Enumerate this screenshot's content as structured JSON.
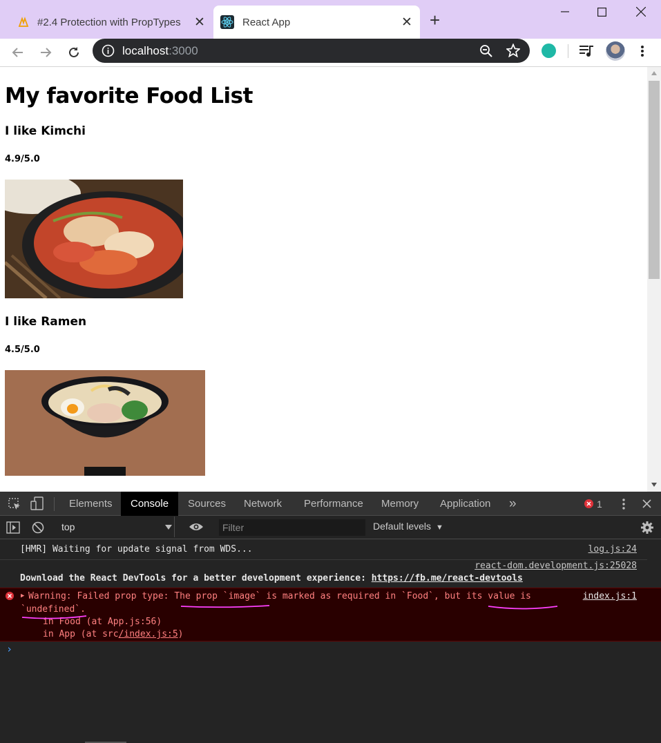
{
  "browser": {
    "tabs": [
      {
        "title": "#2.4 Protection with PropTypes",
        "icon": "nomad-logo-icon",
        "close": "✕"
      },
      {
        "title": "React App",
        "icon": "react-logo-icon",
        "close": "✕"
      }
    ],
    "new_tab": "+",
    "url_host": "localhost",
    "url_port": ":3000"
  },
  "page": {
    "heading": "My favorite Food List",
    "foods": [
      {
        "title": "I like Kimchi",
        "rating": "4.9/5.0",
        "image": "kimchi-photo"
      },
      {
        "title": "I like Ramen",
        "rating": "4.5/5.0",
        "image": "ramen-photo"
      }
    ]
  },
  "devtools": {
    "tabs": [
      "Elements",
      "Console",
      "Sources",
      "Network",
      "Performance",
      "Memory",
      "Application"
    ],
    "more": "»",
    "error_count": "1",
    "context": "top",
    "filter_placeholder": "Filter",
    "levels": "Default levels",
    "messages": {
      "hmr": "[HMR] Waiting for update signal from WDS...",
      "hmr_src": "log.js:24",
      "react_src": "react-dom.development.js:25028",
      "react_text": "Download the React DevTools for a better development experience: ",
      "react_link": "https://fb.me/react-devtools",
      "err_line1": "Warning: Failed prop type: The prop `image` is marked as required in `Food`, but its value is",
      "err_line2": "`undefined`.",
      "err_src": "index.js:1",
      "err_stack1": "in Food (at App.js:56)",
      "err_stack2_a": "in App (at src",
      "err_stack2_b": "/index.js:5",
      "err_stack2_c": ")"
    },
    "prompt": "›"
  },
  "colors": {
    "titlebar": "#e0cdf6",
    "omnibox": "#292a2d",
    "devtools_bg": "#242424",
    "error_bg": "#290000",
    "error_text": "#ff8080",
    "annotation": "#ff40ff"
  }
}
